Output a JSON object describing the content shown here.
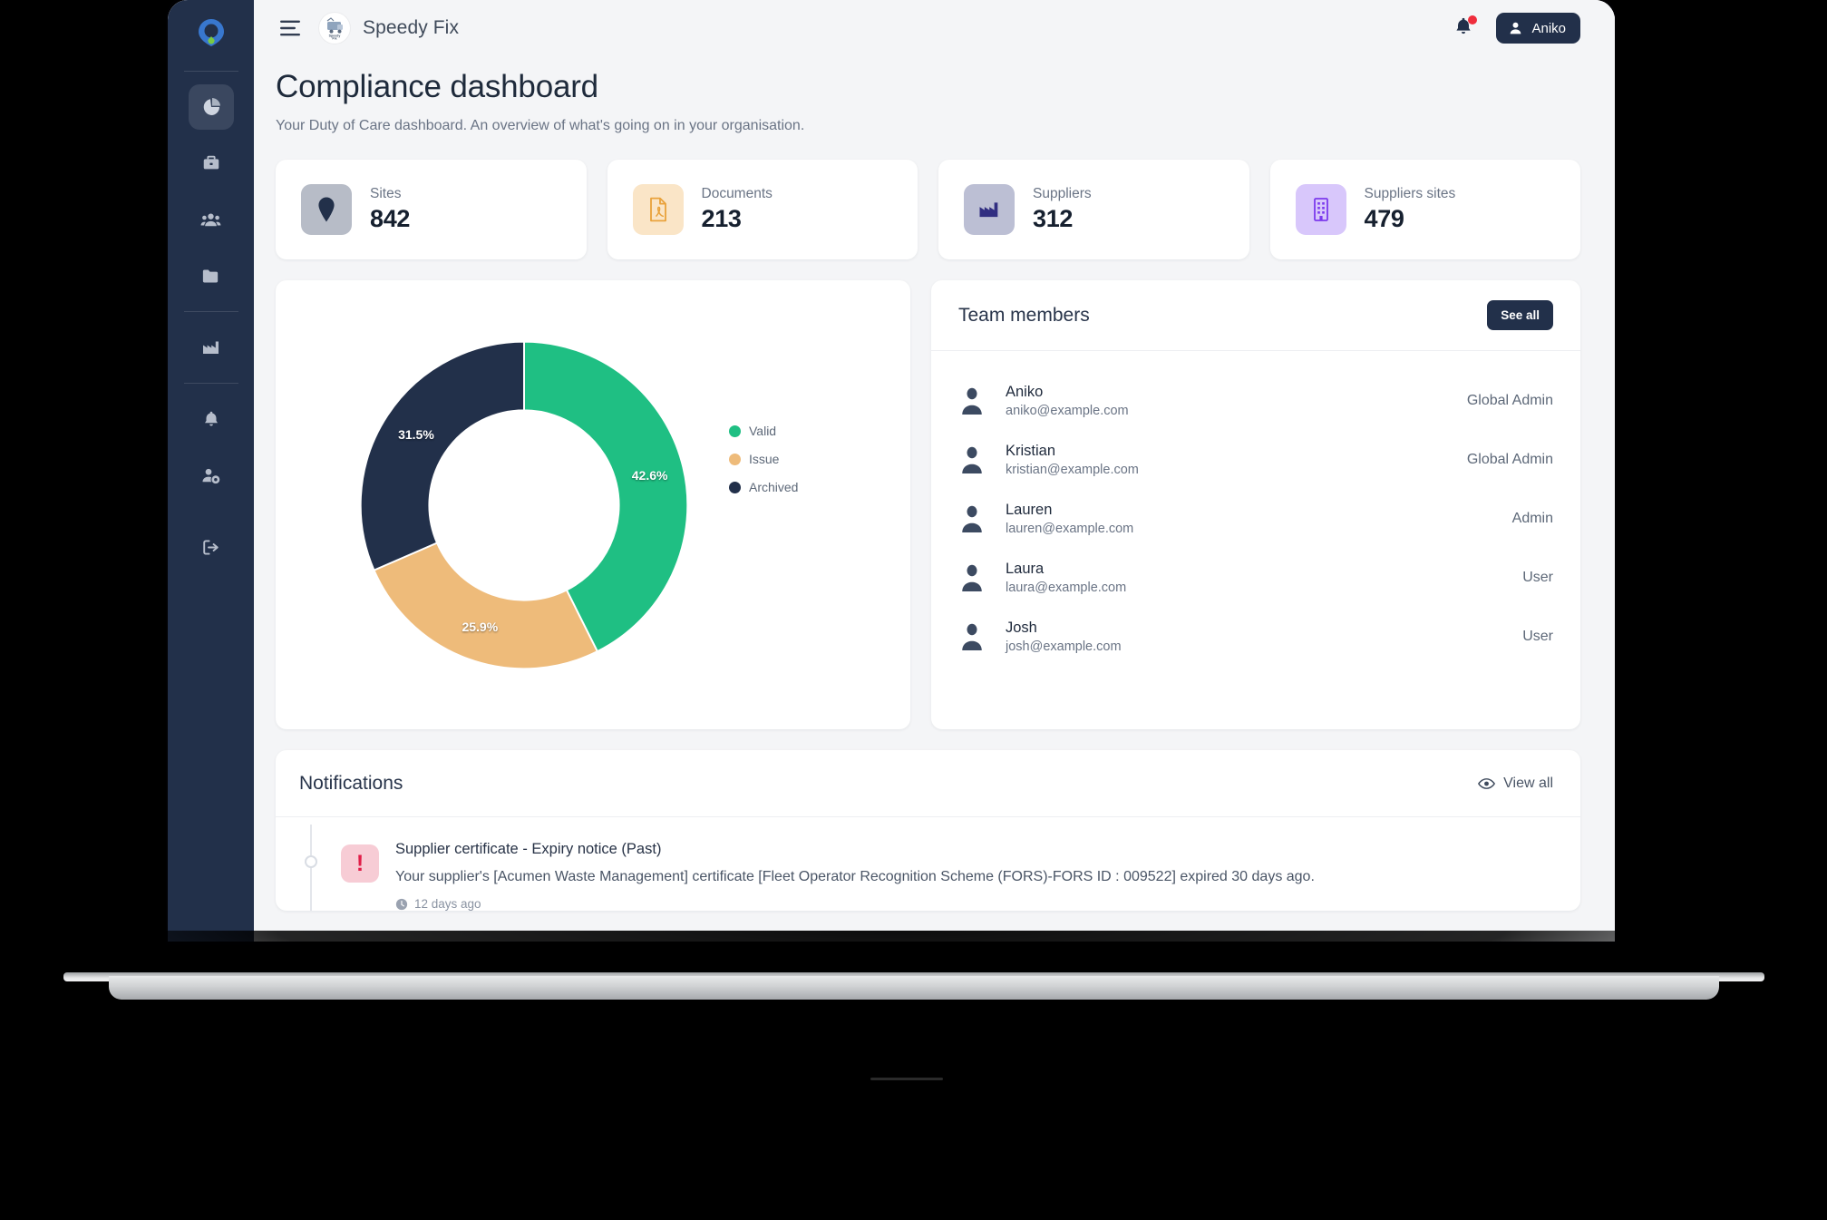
{
  "sidebar": {
    "brand_icon": "location-pin-logo-icon",
    "items": [
      {
        "icon": "pie-chart-icon",
        "name": "dashboard",
        "active": true
      },
      {
        "icon": "briefcase-icon",
        "name": "jobs",
        "active": false
      },
      {
        "icon": "users-group-icon",
        "name": "team",
        "active": false
      },
      {
        "icon": "folder-icon",
        "name": "documents",
        "active": false
      },
      {
        "icon": "factory-icon",
        "name": "suppliers",
        "active": false
      },
      {
        "icon": "bell-icon",
        "name": "notifications",
        "active": false
      },
      {
        "icon": "user-settings-icon",
        "name": "account-settings",
        "active": false
      },
      {
        "icon": "logout-icon",
        "name": "logout",
        "active": false
      }
    ]
  },
  "topbar": {
    "menu_icon": "hamburger-menu-icon",
    "logo_icon": "speedy-fix-logo-icon",
    "app_title": "Speedy Fix",
    "bell_icon": "bell-icon",
    "has_notification_dot": true,
    "user_icon": "user-avatar-icon",
    "user_name": "Aniko"
  },
  "page": {
    "title": "Compliance dashboard",
    "subtitle": "Your Duty of Care dashboard. An overview of what's going on in your organisation."
  },
  "stats": [
    {
      "label": "Sites",
      "value": "842",
      "icon": "map-pin-icon",
      "icon_bg": "#b7bcc7",
      "icon_fg": "#22304a"
    },
    {
      "label": "Documents",
      "value": "213",
      "icon": "pdf-file-icon",
      "icon_bg": "#fae5c7",
      "icon_fg": "#e9a23b"
    },
    {
      "label": "Suppliers",
      "value": "312",
      "icon": "factory-icon",
      "icon_bg": "#bcbfd4",
      "icon_fg": "#312e81"
    },
    {
      "label": "Suppliers sites",
      "value": "479",
      "icon": "building-icon",
      "icon_bg": "#d8c7fb",
      "icon_fg": "#7c3aed"
    }
  ],
  "chart_data": {
    "type": "pie",
    "variant": "donut",
    "title": "",
    "categories": [
      "Valid",
      "Issue",
      "Archived"
    ],
    "values": [
      42.6,
      25.9,
      31.5
    ],
    "value_unit": "%",
    "data_labels": [
      "42.6%",
      "25.9%",
      "31.5%"
    ],
    "colors": [
      "#1fbf83",
      "#eebb7a",
      "#22304a"
    ],
    "legend": {
      "position": "right",
      "entries": [
        {
          "label": "Valid",
          "color": "#1fbf83"
        },
        {
          "label": "Issue",
          "color": "#eebb7a"
        },
        {
          "label": "Archived",
          "color": "#22304a"
        }
      ]
    },
    "start_angle_deg": 0,
    "inner_radius_ratio": 0.58
  },
  "team": {
    "title": "Team members",
    "see_all_label": "See all",
    "members": [
      {
        "avatar": "user-avatar-icon",
        "name": "Aniko",
        "email": "aniko@example.com",
        "role": "Global Admin"
      },
      {
        "avatar": "user-avatar-icon",
        "name": "Kristian",
        "email": "kristian@example.com",
        "role": "Global Admin"
      },
      {
        "avatar": "user-avatar-icon",
        "name": "Lauren",
        "email": "lauren@example.com",
        "role": "Admin"
      },
      {
        "avatar": "user-avatar-icon",
        "name": "Laura",
        "email": "laura@example.com",
        "role": "User"
      },
      {
        "avatar": "user-avatar-icon",
        "name": "Josh",
        "email": "josh@example.com",
        "role": "User"
      }
    ]
  },
  "notifications": {
    "title": "Notifications",
    "view_all_label": "View all",
    "view_all_icon": "eye-icon",
    "items": [
      {
        "severity_icon": "exclamation-icon",
        "severity_color": "#e11d48",
        "severity_bg": "#f7ccd5",
        "subject": "Supplier certificate - Expiry notice (Past)",
        "text": "Your supplier's [Acumen Waste Management] certificate [Fleet Operator Recognition Scheme (FORS)-FORS ID : 009522] expired 30 days ago.",
        "time_icon": "clock-icon",
        "time": "12 days ago"
      }
    ]
  },
  "theme": {
    "sidebar_bg": "#22304a",
    "page_bg": "#f4f5f7",
    "card_bg": "#ffffff",
    "accent_dark": "#22304a",
    "accent_green": "#1fbf83",
    "accent_orange": "#eebb7a",
    "danger": "#e11d48",
    "notification_dot": "#ef2d3c"
  }
}
